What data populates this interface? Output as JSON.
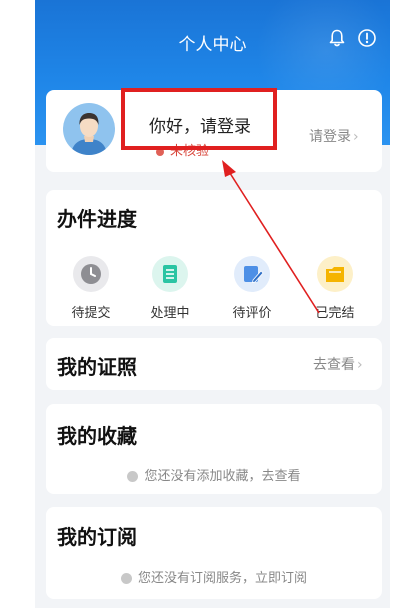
{
  "header": {
    "title": "个人中心",
    "bell_icon": "bell-icon",
    "info_icon": "info-icon"
  },
  "profile": {
    "greeting": "你好，请登录",
    "status": "未核验",
    "login_link": "请登录"
  },
  "progress": {
    "title": "办件进度",
    "items": [
      {
        "label": "待提交",
        "icon": "clock-icon",
        "color": "#8e8e93"
      },
      {
        "label": "处理中",
        "icon": "document-list-icon",
        "color": "#2bc4a3"
      },
      {
        "label": "待评价",
        "icon": "edit-icon",
        "color": "#4d8fe6"
      },
      {
        "label": "已完结",
        "icon": "folder-icon",
        "color": "#f5b400"
      }
    ]
  },
  "certificates": {
    "title": "我的证照",
    "link": "去查看"
  },
  "favorites": {
    "title": "我的收藏",
    "empty_text": "您还没有添加收藏，去查看"
  },
  "subscriptions": {
    "title": "我的订阅",
    "empty_text": "您还没有订阅服务，立即订阅"
  },
  "colors": {
    "header_blue": "#1f86e8",
    "annotation_red": "#e02020"
  }
}
